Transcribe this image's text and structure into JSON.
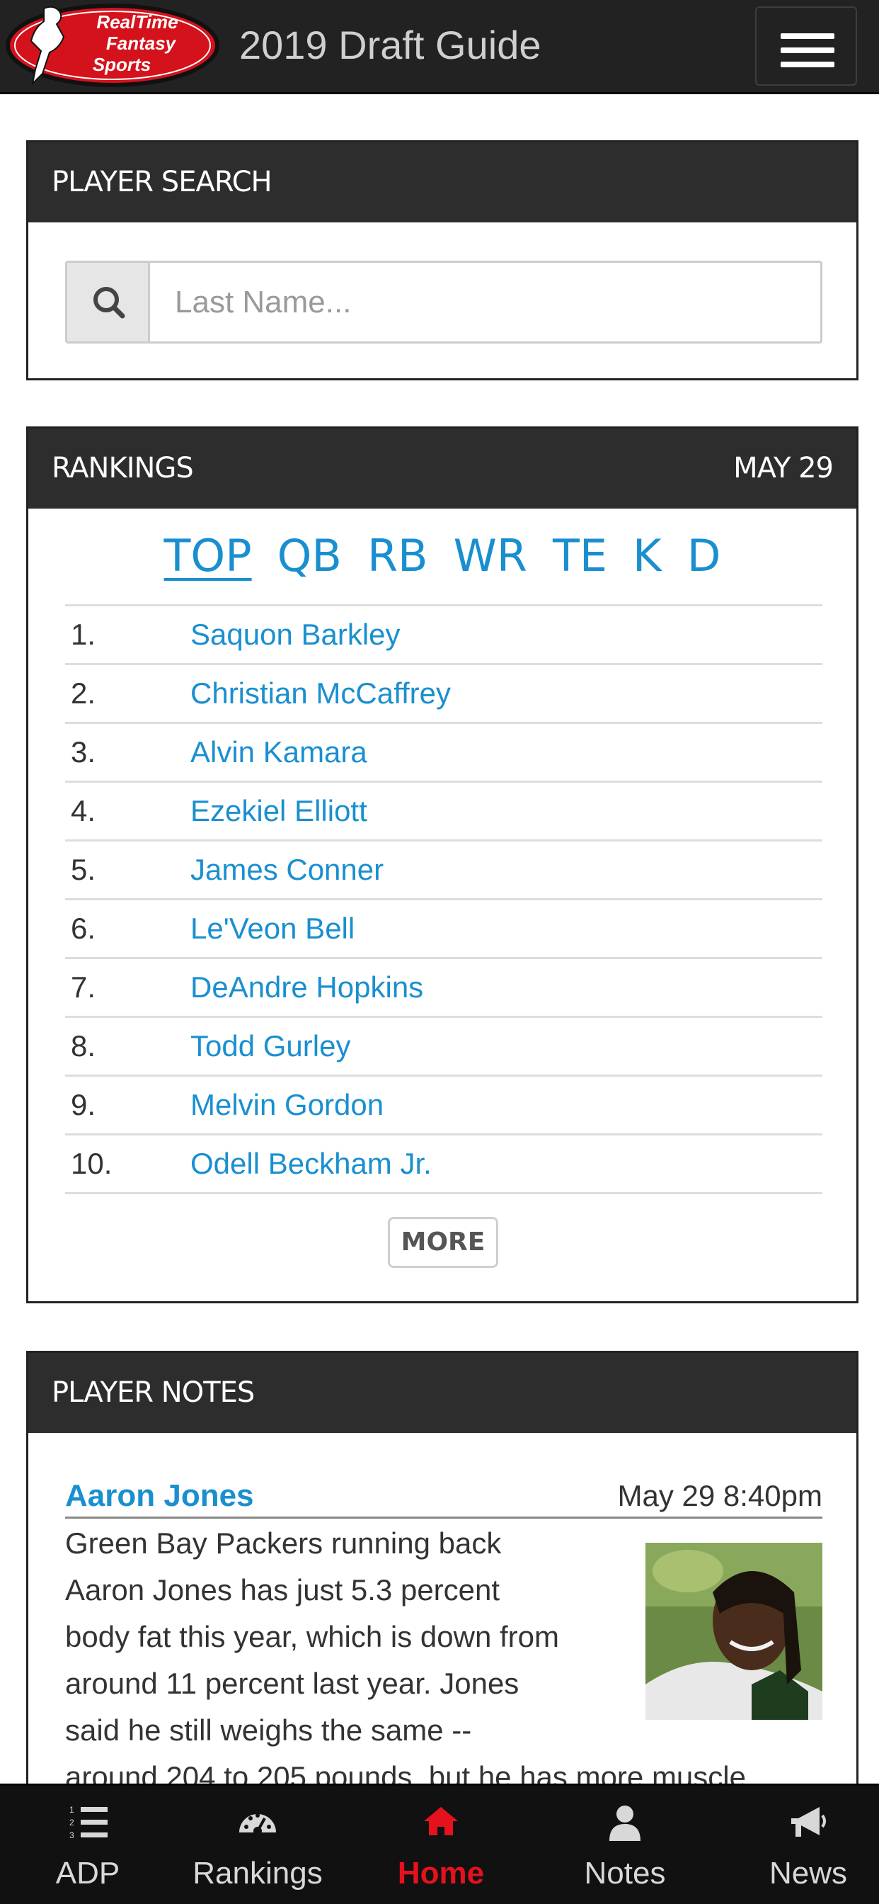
{
  "header": {
    "logo_text": [
      "RealTime",
      "Fantasy",
      "Sports"
    ],
    "title": "2019 Draft Guide",
    "menu_icon": "hamburger-menu-icon"
  },
  "player_search": {
    "heading": "PLAYER SEARCH",
    "search_icon": "search-icon",
    "placeholder": "Last Name...",
    "value": ""
  },
  "rankings": {
    "heading": "RANKINGS",
    "date": "MAY 29",
    "tabs": [
      "TOP",
      "QB",
      "RB",
      "WR",
      "TE",
      "K",
      "D"
    ],
    "active_tab": "TOP",
    "rows": [
      {
        "rank": "1.",
        "name": "Saquon Barkley"
      },
      {
        "rank": "2.",
        "name": "Christian McCaffrey"
      },
      {
        "rank": "3.",
        "name": "Alvin Kamara"
      },
      {
        "rank": "4.",
        "name": "Ezekiel Elliott"
      },
      {
        "rank": "5.",
        "name": "James Conner"
      },
      {
        "rank": "6.",
        "name": "Le'Veon Bell"
      },
      {
        "rank": "7.",
        "name": "DeAndre Hopkins"
      },
      {
        "rank": "8.",
        "name": "Todd Gurley"
      },
      {
        "rank": "9.",
        "name": "Melvin Gordon"
      },
      {
        "rank": "10.",
        "name": "Odell Beckham Jr."
      }
    ],
    "more_label": "MORE"
  },
  "player_notes": {
    "heading": "PLAYER NOTES",
    "note": {
      "player": "Aaron Jones",
      "timestamp": "May 29 8:40pm",
      "body_lines": [
        "Green Bay Packers running back",
        "Aaron Jones has just 5.3 percent",
        "body fat this year, which is down from",
        "around 11 percent last year. Jones",
        "said he still weighs the same --",
        "around 204 to 205 pounds, but he has more muscle"
      ]
    }
  },
  "bottom_nav": {
    "items": [
      {
        "label": "ADP",
        "icon": "list-numbered-icon"
      },
      {
        "label": "Rankings",
        "icon": "dashboard-gauge-icon"
      },
      {
        "label": "Home",
        "icon": "home-icon"
      },
      {
        "label": "Notes",
        "icon": "user-icon"
      },
      {
        "label": "News",
        "icon": "bullhorn-icon"
      }
    ],
    "active": "Home"
  },
  "colors": {
    "link_blue": "#1a8fd0",
    "panel_header": "#2d2d2d",
    "active_nav": "#e5121d",
    "logo_red": "#d4121c"
  }
}
